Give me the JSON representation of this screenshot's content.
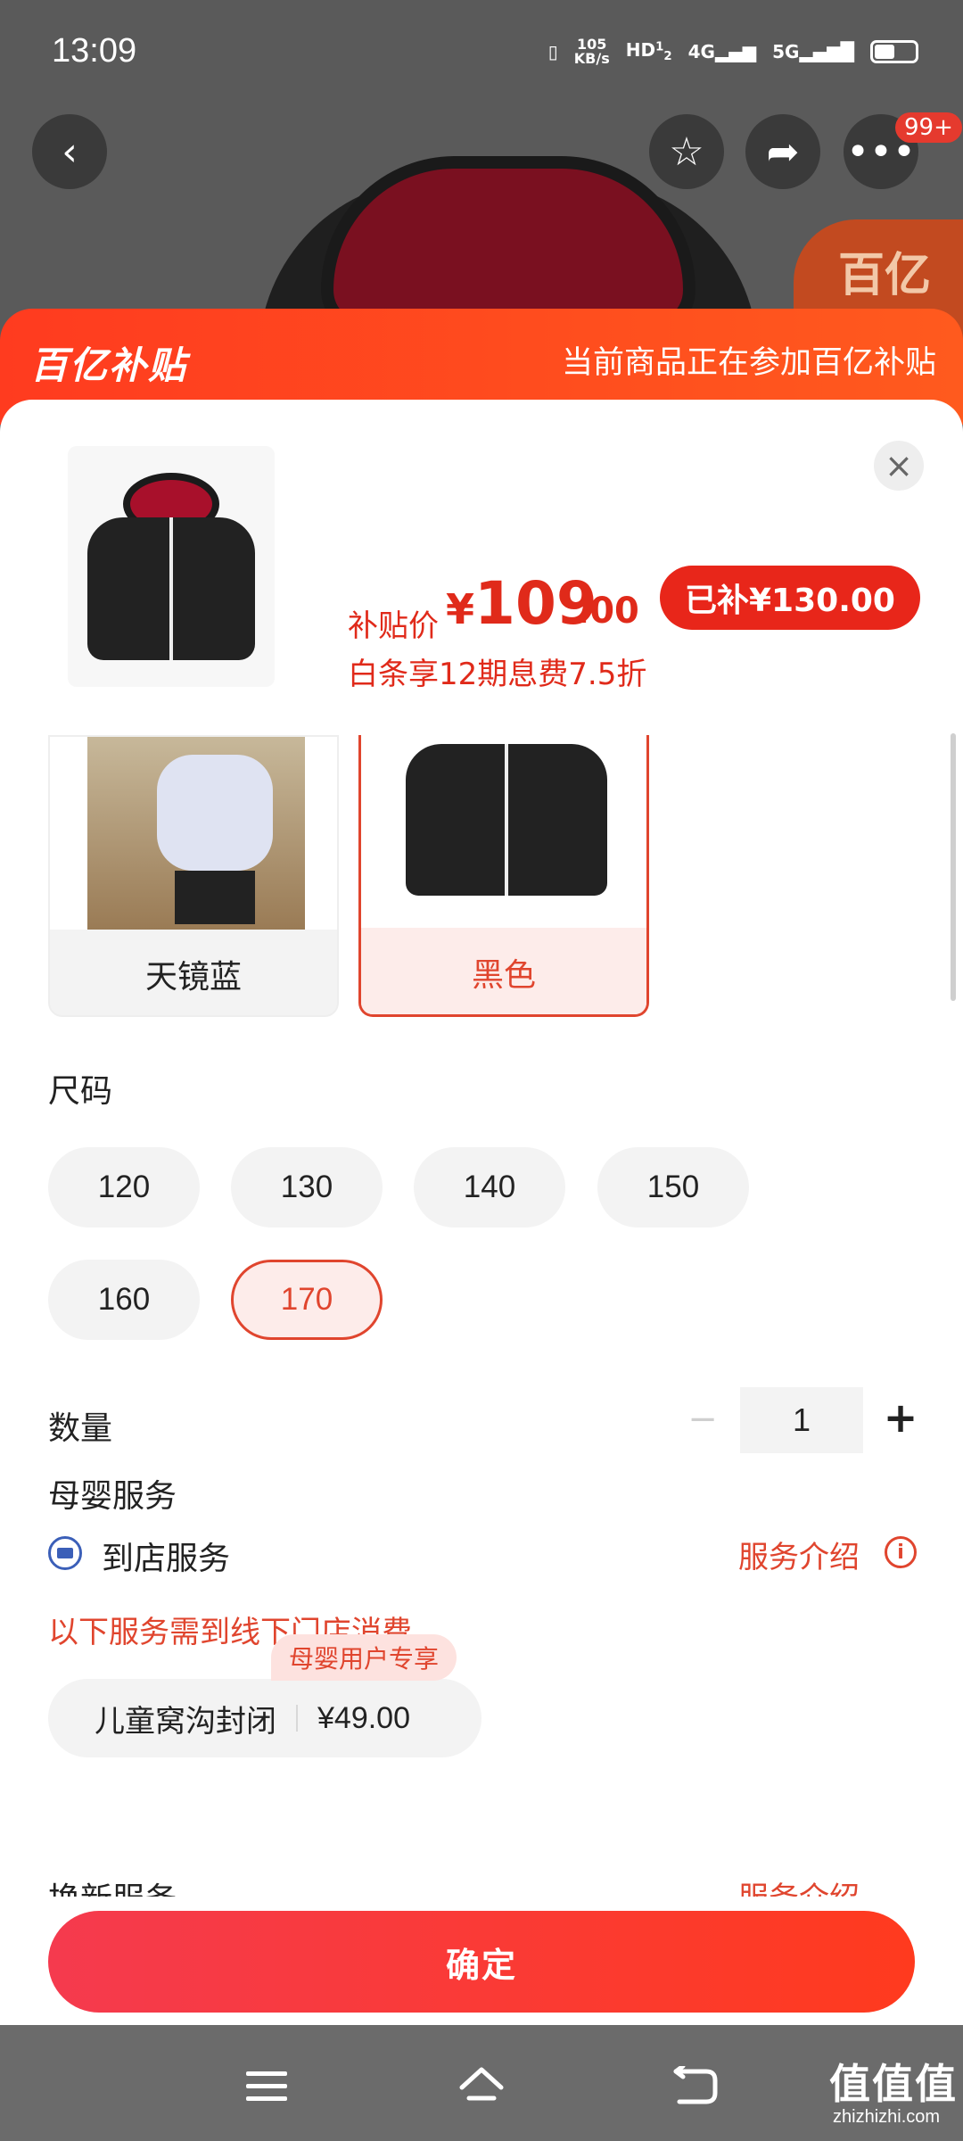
{
  "status_bar": {
    "time": "13:09",
    "net_speed_top": "105",
    "net_speed_unit": "KB/s",
    "hd": "HD",
    "sim1": "1",
    "sim2": "2",
    "net_4g": "4G",
    "net_5g": "5G"
  },
  "top_bar": {
    "notification_badge": "99+",
    "bg_badge_text": "百亿"
  },
  "banner": {
    "logo": "百亿补贴",
    "text": "当前商品正在参加百亿补贴"
  },
  "product": {
    "price_label": "补贴价",
    "price_currency": "¥",
    "price_integer": "109",
    "price_cents": ".00",
    "subsidy_tag": "已补¥130.00",
    "installment": "白条享12期息费7.5折"
  },
  "colors": {
    "options": [
      {
        "label": "天镜蓝",
        "selected": false
      },
      {
        "label": "黑色",
        "selected": true
      }
    ]
  },
  "size": {
    "title": "尺码",
    "options": [
      "120",
      "130",
      "140",
      "150",
      "160",
      "170"
    ],
    "selected": "170"
  },
  "quantity": {
    "title": "数量",
    "minus": "−",
    "value": "1",
    "plus": "+"
  },
  "services": {
    "title": "母婴服务",
    "store_service": "到店服务",
    "intro": "服务介绍",
    "offline_note": "以下服务需到线下门店消费",
    "exclusive_tag": "母婴用户专享",
    "item_name": "儿童窝沟封闭",
    "item_price": "¥49.00",
    "next_service_partial": "换新服务",
    "next_intro_partial": "服务介绍"
  },
  "confirm": {
    "label": "确定"
  },
  "watermark": {
    "main": "值值值",
    "sub": "zhizhizhi.com"
  },
  "accent_colors": {
    "primary": "#e0452e",
    "banner": "#ff3b1f",
    "pill": "#e8261a"
  }
}
